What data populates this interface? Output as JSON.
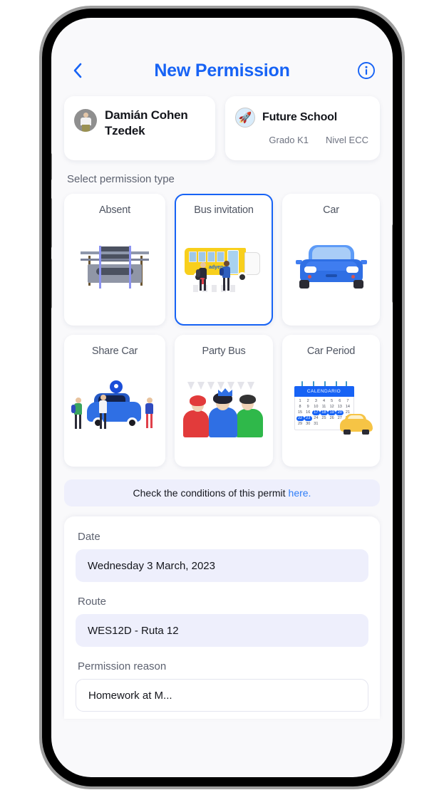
{
  "header": {
    "back_icon": "chevron-left-icon",
    "title": "New Permission",
    "info_icon": "info-circle-icon"
  },
  "student": {
    "name": "Damián Cohen Tzedek",
    "avatar_icon": "student-avatar"
  },
  "school": {
    "logo_icon": "rocket-icon",
    "name": "Future School",
    "grade": "Grado K1",
    "level": "Nivel ECC"
  },
  "section": {
    "label": "Select permission type"
  },
  "permission_types": [
    {
      "label": "Absent",
      "art": "bed",
      "selected": false
    },
    {
      "label": "Bus invitation",
      "art": "bus",
      "selected": true
    },
    {
      "label": "Car",
      "art": "car",
      "selected": false
    },
    {
      "label": "Share Car",
      "art": "share",
      "selected": false
    },
    {
      "label": "Party Bus",
      "art": "party",
      "selected": false
    },
    {
      "label": "Car Period",
      "art": "calendar",
      "selected": false
    }
  ],
  "conditions": {
    "text": "Check the conditions of this permit",
    "link_label": "here."
  },
  "form": {
    "date_label": "Date",
    "date_value": "Wednesday 3 March, 2023",
    "route_label": "Route",
    "route_value": "WES12D - Ruta 12",
    "reason_label": "Permission reason",
    "reason_value": "Homework at M..."
  },
  "calendar_art": {
    "title": "CALENDARIO",
    "days": [
      1,
      2,
      3,
      4,
      5,
      6,
      7,
      8,
      9,
      10,
      11,
      12,
      13,
      14,
      15,
      16,
      17,
      18,
      19,
      20,
      21,
      22,
      23,
      24,
      25,
      26,
      27,
      28,
      29,
      30,
      31
    ],
    "highlighted": [
      17,
      18,
      19,
      20,
      22,
      23
    ]
  },
  "bus_art": {
    "logo_text": "adyen"
  },
  "colors": {
    "accent": "#1763f5",
    "title": "#1763f5",
    "field_bg": "#eeeffc",
    "screen_bg": "#f9f9fb",
    "label": "#5d6270"
  }
}
